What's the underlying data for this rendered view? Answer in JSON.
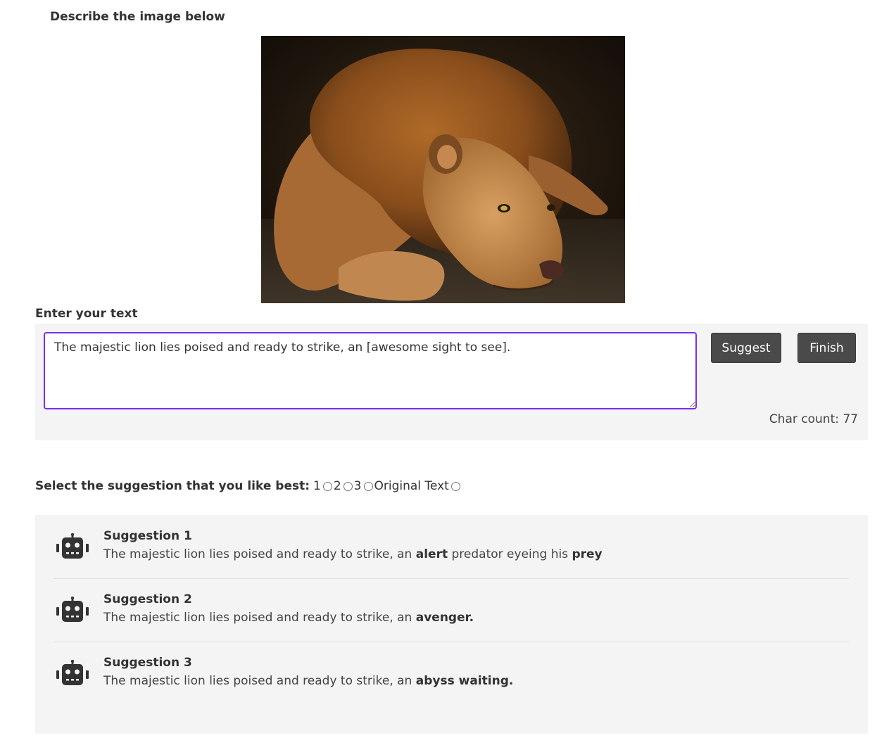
{
  "prompt_label": "Describe the image below",
  "image": {
    "subject": "lion lying down"
  },
  "editor": {
    "label": "Enter your text",
    "text": "The majestic lion lies poised and ready to strike, an [awesome sight to see].",
    "suggest_label": "Suggest",
    "finish_label": "Finish",
    "char_count": "Char count: 77"
  },
  "selection": {
    "label": "Select the suggestion that you like best:",
    "options": [
      "1",
      "2",
      "3",
      "Original Text"
    ]
  },
  "suggestions": [
    {
      "title": "Suggestion 1",
      "prefix": "The majestic lion lies poised and ready to strike, an ",
      "b1": "alert",
      "mid": " predator eyeing his ",
      "b2": "prey"
    },
    {
      "title": "Suggestion 2",
      "prefix": "The majestic lion lies poised and ready to strike, an ",
      "b1": "avenger."
    },
    {
      "title": "Suggestion 3",
      "prefix": "The majestic lion lies poised and ready to strike, an ",
      "b1": "abyss waiting."
    }
  ],
  "icons": {
    "suggestion": "robot-icon",
    "accent": "#7b2ff0",
    "button": "#4a4a4a"
  }
}
